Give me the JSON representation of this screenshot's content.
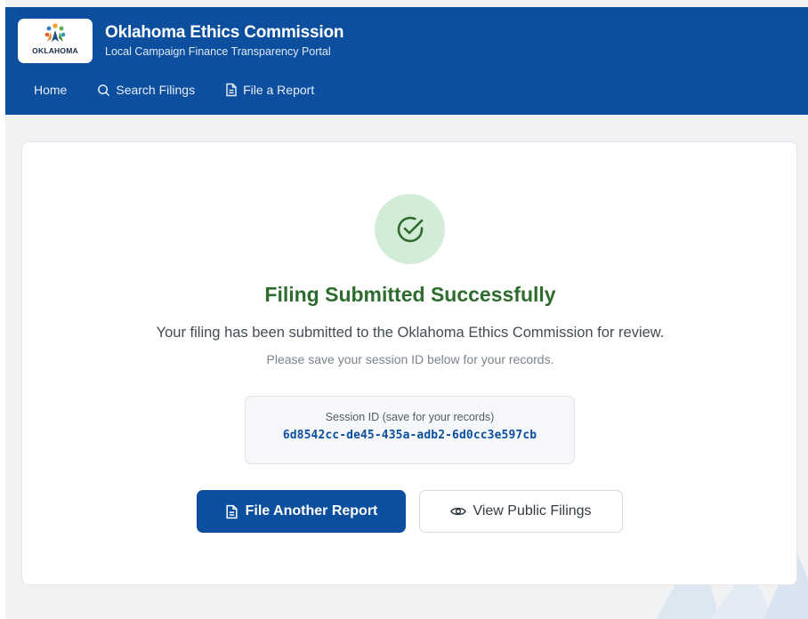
{
  "header": {
    "logo_text": "OKLAHOMA",
    "title": "Oklahoma Ethics Commission",
    "subtitle": "Local Campaign Finance Transparency Portal",
    "background_color": "#0c4f9e"
  },
  "nav": {
    "items": [
      {
        "label": "Home",
        "icon": ""
      },
      {
        "label": "Search Filings",
        "icon": "search-icon"
      },
      {
        "label": "File a Report",
        "icon": "document-icon"
      }
    ]
  },
  "confirmation": {
    "icon": "check-circle-icon",
    "title": "Filing Submitted Successfully",
    "message": "Your filing has been submitted to the Oklahoma Ethics Commission for review.",
    "note": "Please save your session ID below for your records.",
    "session_label": "Session ID (save for your records)",
    "session_id": "6d8542cc-de45-435a-adb2-6d0cc3e597cb",
    "accent_color": "#2e6b2e"
  },
  "actions": {
    "primary_label": "File Another Report",
    "primary_icon": "document-icon",
    "secondary_label": "View Public Filings",
    "secondary_icon": "eye-icon"
  }
}
